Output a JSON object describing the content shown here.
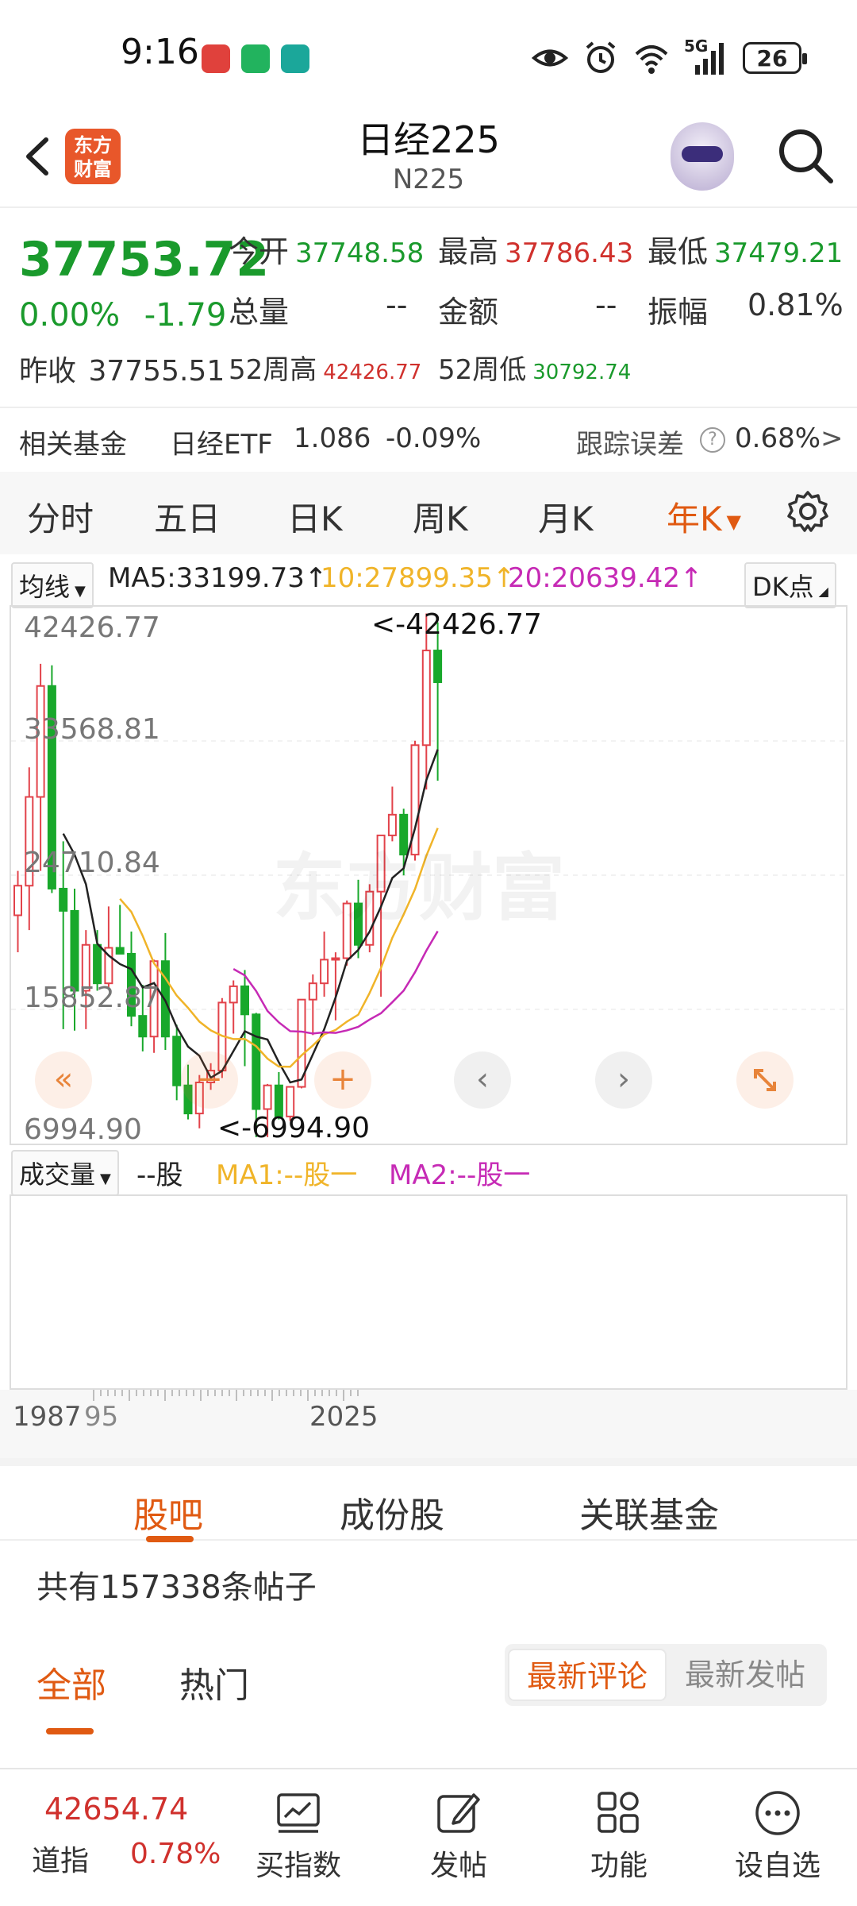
{
  "status_bar": {
    "time": "9:16",
    "network": "5G",
    "battery": "26"
  },
  "header": {
    "app_logo_text": "东方财富",
    "title": "日经225",
    "subtitle": "N225"
  },
  "quote": {
    "price": "37753.72",
    "change_pct": "0.00%",
    "change_val": "-1.79",
    "prev_close_label": "昨收",
    "prev_close": "37755.51",
    "open_label": "今开",
    "open": "37748.58",
    "high_label": "最高",
    "high": "37786.43",
    "low_label": "最低",
    "low": "37479.21",
    "volume_label": "总量",
    "volume": "--",
    "amount_label": "金额",
    "amount": "--",
    "amplitude_label": "振幅",
    "amplitude": "0.81%",
    "w52_high_label": "52周高",
    "w52_high": "42426.77",
    "w52_low_label": "52周低",
    "w52_low": "30792.74"
  },
  "fund_row": {
    "label": "相关基金",
    "fund_name": "日经ETF",
    "fund_price": "1.086",
    "fund_change": "-0.09%",
    "tracking_label": "跟踪误差",
    "tracking_value": "0.68%",
    "arrow": ">"
  },
  "period_tabs": [
    "分时",
    "五日",
    "日K",
    "周K",
    "月K",
    "年K"
  ],
  "active_period": "年K",
  "ma_row": {
    "select_label": "均线",
    "ma5": "MA5:33199.73↑",
    "ma10": "10:27899.35↑",
    "ma20": "20:20639.42↑",
    "dk_label": "DK点",
    "colors": {
      "ma5": "#222222",
      "ma10": "#f0b429",
      "ma20": "#c62ab5"
    }
  },
  "chart": {
    "price_labels": [
      "42426.77",
      "33568.81",
      "24710.84",
      "15852.87",
      "6994.90"
    ],
    "max_marker": "<-42426.77",
    "min_marker": "<-6994.90",
    "watermark": "东方财富",
    "nav_buttons": {
      "prev": "‹",
      "next": "›"
    }
  },
  "chart_data": {
    "type": "candlestick",
    "y_range": [
      6994.9,
      42426.77
    ],
    "x_labels": [
      "1987",
      "95",
      "2025"
    ],
    "ohlc_approx": [
      [
        22000,
        25000,
        19500,
        24000
      ],
      [
        24000,
        32000,
        21000,
        30000
      ],
      [
        30000,
        39000,
        25000,
        37500
      ],
      [
        37500,
        38900,
        23500,
        23800
      ],
      [
        23800,
        27000,
        14300,
        22300
      ],
      [
        22300,
        23800,
        14200,
        16900
      ],
      [
        16900,
        21000,
        14300,
        20000
      ],
      [
        20000,
        21000,
        16900,
        17400
      ],
      [
        17400,
        22600,
        17000,
        19800
      ],
      [
        19800,
        22700,
        19400,
        19400
      ],
      [
        19400,
        20900,
        14500,
        15200
      ],
      [
        15200,
        17300,
        12800,
        13800
      ],
      [
        13800,
        19000,
        12700,
        18900
      ],
      [
        18900,
        20800,
        12900,
        13800
      ],
      [
        13800,
        14600,
        9500,
        10500
      ],
      [
        10500,
        11900,
        8200,
        8600
      ],
      [
        8600,
        11200,
        7600,
        10700
      ],
      [
        10700,
        12000,
        10200,
        11500
      ],
      [
        11500,
        16400,
        11000,
        16100
      ],
      [
        16100,
        17600,
        14000,
        17200
      ],
      [
        17200,
        18300,
        11800,
        15300
      ],
      [
        15300,
        15400,
        7000,
        8900
      ],
      [
        8900,
        10600,
        7000,
        10500
      ],
      [
        10500,
        11400,
        8200,
        8400
      ],
      [
        8400,
        10300,
        8100,
        10400
      ],
      [
        10400,
        16300,
        10300,
        16300
      ],
      [
        16300,
        18000,
        13900,
        17400
      ],
      [
        17400,
        20900,
        16500,
        19000
      ],
      [
        19000,
        19500,
        14900,
        19100
      ],
      [
        19100,
        23000,
        18600,
        22800
      ],
      [
        22800,
        24400,
        19100,
        20000
      ],
      [
        20000,
        24100,
        19500,
        23600
      ],
      [
        23600,
        27400,
        16500,
        27400
      ],
      [
        27400,
        30700,
        27000,
        28800
      ],
      [
        28800,
        29200,
        24700,
        26100
      ],
      [
        26100,
        33800,
        25700,
        33500
      ],
      [
        33500,
        42400,
        30500,
        39900
      ],
      [
        39900,
        41800,
        31100,
        37754
      ]
    ],
    "ma_series": [
      {
        "name": "MA5",
        "value": 33199.73
      },
      {
        "name": "10",
        "value": 27899.35
      },
      {
        "name": "20",
        "value": 20639.42
      }
    ]
  },
  "volume": {
    "select_label": "成交量",
    "unit": "--股",
    "ma1": "MA1:--股一",
    "ma2": "MA2:--股一"
  },
  "axis_labels": [
    "1987",
    "95",
    "2025"
  ],
  "section_tabs": [
    "股吧",
    "成份股",
    "关联基金"
  ],
  "active_section": "股吧",
  "posts_count": "共有157338条帖子",
  "filter_tabs": [
    "全部",
    "热门"
  ],
  "sort_options": [
    "最新评论",
    "最新发帖"
  ],
  "bottom_nav": {
    "djia_value": "42654.74",
    "djia_name": "道指",
    "djia_change": "0.78%",
    "items": [
      "买指数",
      "发帖",
      "功能",
      "设自选"
    ]
  }
}
